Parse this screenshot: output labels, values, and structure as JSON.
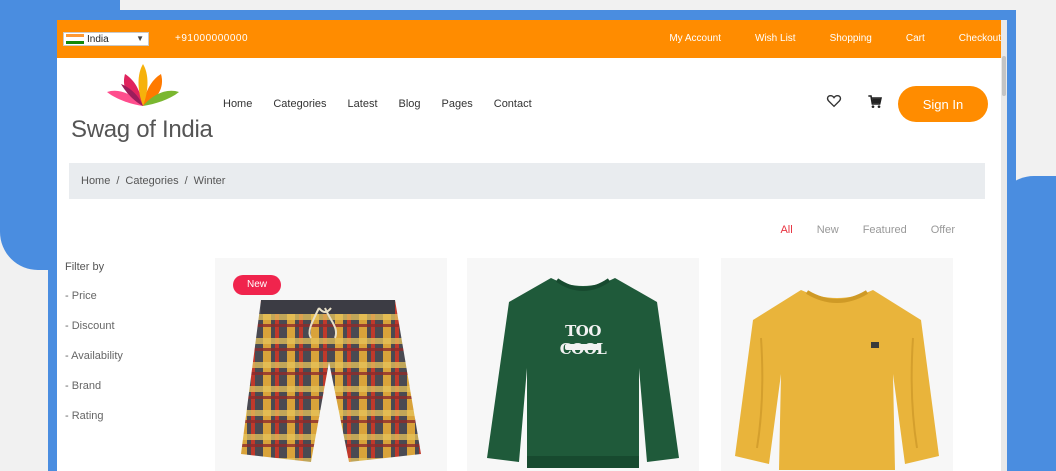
{
  "topbar": {
    "country": "India",
    "phone": "+91000000000",
    "links": [
      "My Account",
      "Wish List",
      "Shopping",
      "Cart",
      "Checkout"
    ]
  },
  "header": {
    "brand": "Swag of India",
    "nav": [
      "Home",
      "Categories",
      "Latest",
      "Blog",
      "Pages",
      "Contact"
    ],
    "signin_label": "Sign In"
  },
  "breadcrumb": [
    "Home",
    "Categories",
    "Winter"
  ],
  "product_tabs": [
    "All",
    "New",
    "Featured",
    "Offer"
  ],
  "sidebar": {
    "title": "Filter by",
    "items": [
      "Price",
      "Discount",
      "Availability",
      "Brand",
      "Rating"
    ]
  },
  "products": [
    {
      "badge": "New",
      "kind": "plaid-shorts"
    },
    {
      "badge": "",
      "kind": "green-sweatshirt",
      "print": "TOO COOL"
    },
    {
      "badge": "",
      "kind": "yellow-sweater"
    }
  ],
  "colors": {
    "accent": "#ff8c00",
    "badge": "#f0244d",
    "frame": "#4a8de0"
  }
}
